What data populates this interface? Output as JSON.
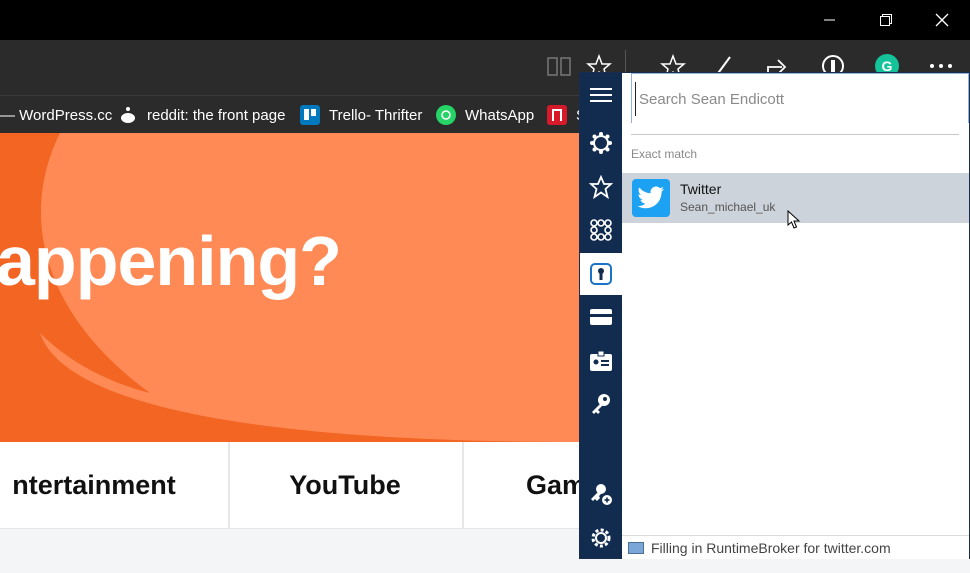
{
  "bookmarks": [
    {
      "label": "— WordPress.cc",
      "icon": "wordpress-icon"
    },
    {
      "label": "reddit: the front page",
      "icon": "reddit-icon"
    },
    {
      "label": "Trello- Thrifter",
      "icon": "trello-icon"
    },
    {
      "label": "WhatsApp",
      "icon": "whatsapp-icon"
    },
    {
      "label": "S",
      "icon": "app-icon"
    }
  ],
  "hero": {
    "title": "appening?"
  },
  "tiles": [
    "ntertainment",
    "YouTube",
    "Gam"
  ],
  "password_manager": {
    "search_placeholder": "Search Sean Endicott",
    "section_label": "Exact match",
    "match": {
      "name": "Twitter",
      "username": "Sean_michael_uk"
    },
    "status": "Filling in RuntimeBroker for twitter.com"
  },
  "colors": {
    "hero_orange": "#f26522",
    "rail_navy": "#122c4f",
    "twitter_blue": "#1da1f2",
    "selected_row": "#cdd3db"
  }
}
